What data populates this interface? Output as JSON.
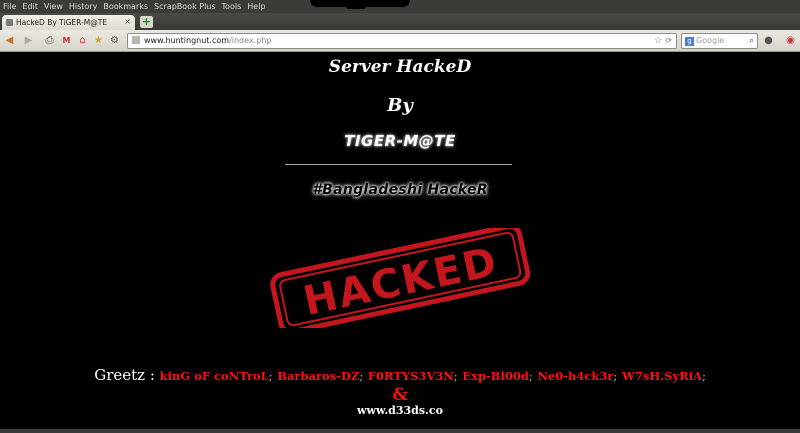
{
  "menu": [
    "File",
    "Edit",
    "View",
    "History",
    "Bookmarks",
    "ScrapBook Plus",
    "Tools",
    "Help"
  ],
  "tab": {
    "title": "HackeD By TiGER-M@TE",
    "close": "×"
  },
  "new_tab": "+",
  "nav": {
    "back": "◀",
    "forward": "▶",
    "print": "⎙",
    "mail": "M",
    "home": "⌂",
    "bookmark": "★",
    "settings": "⚙"
  },
  "url": {
    "host": "www.huntingnut.com",
    "path": "/index.php"
  },
  "search": {
    "engine": "g",
    "placeholder": "Google",
    "icon": "⌕"
  },
  "page": {
    "title": "Server HackeD",
    "by": "By",
    "author": "TIGER-M@TE",
    "hashtag": "#Bangladeshi HackeR",
    "stamp": "HACKED",
    "greetz_label": "Greetz :",
    "greetz": [
      "kinG oF coNTroL",
      "Barbaros-DZ",
      "F0RTYS3V3N",
      "Exp-Bl00d",
      "Ne0-h4ck3r",
      "W7sH.SyRiA"
    ],
    "greetz_sep": ";",
    "amp": "&",
    "site": "www.d33ds.co"
  },
  "colors": {
    "background": "#000000",
    "accent_red": "#ff1010",
    "stamp_red": "#c4161c",
    "text": "#ffffff"
  }
}
